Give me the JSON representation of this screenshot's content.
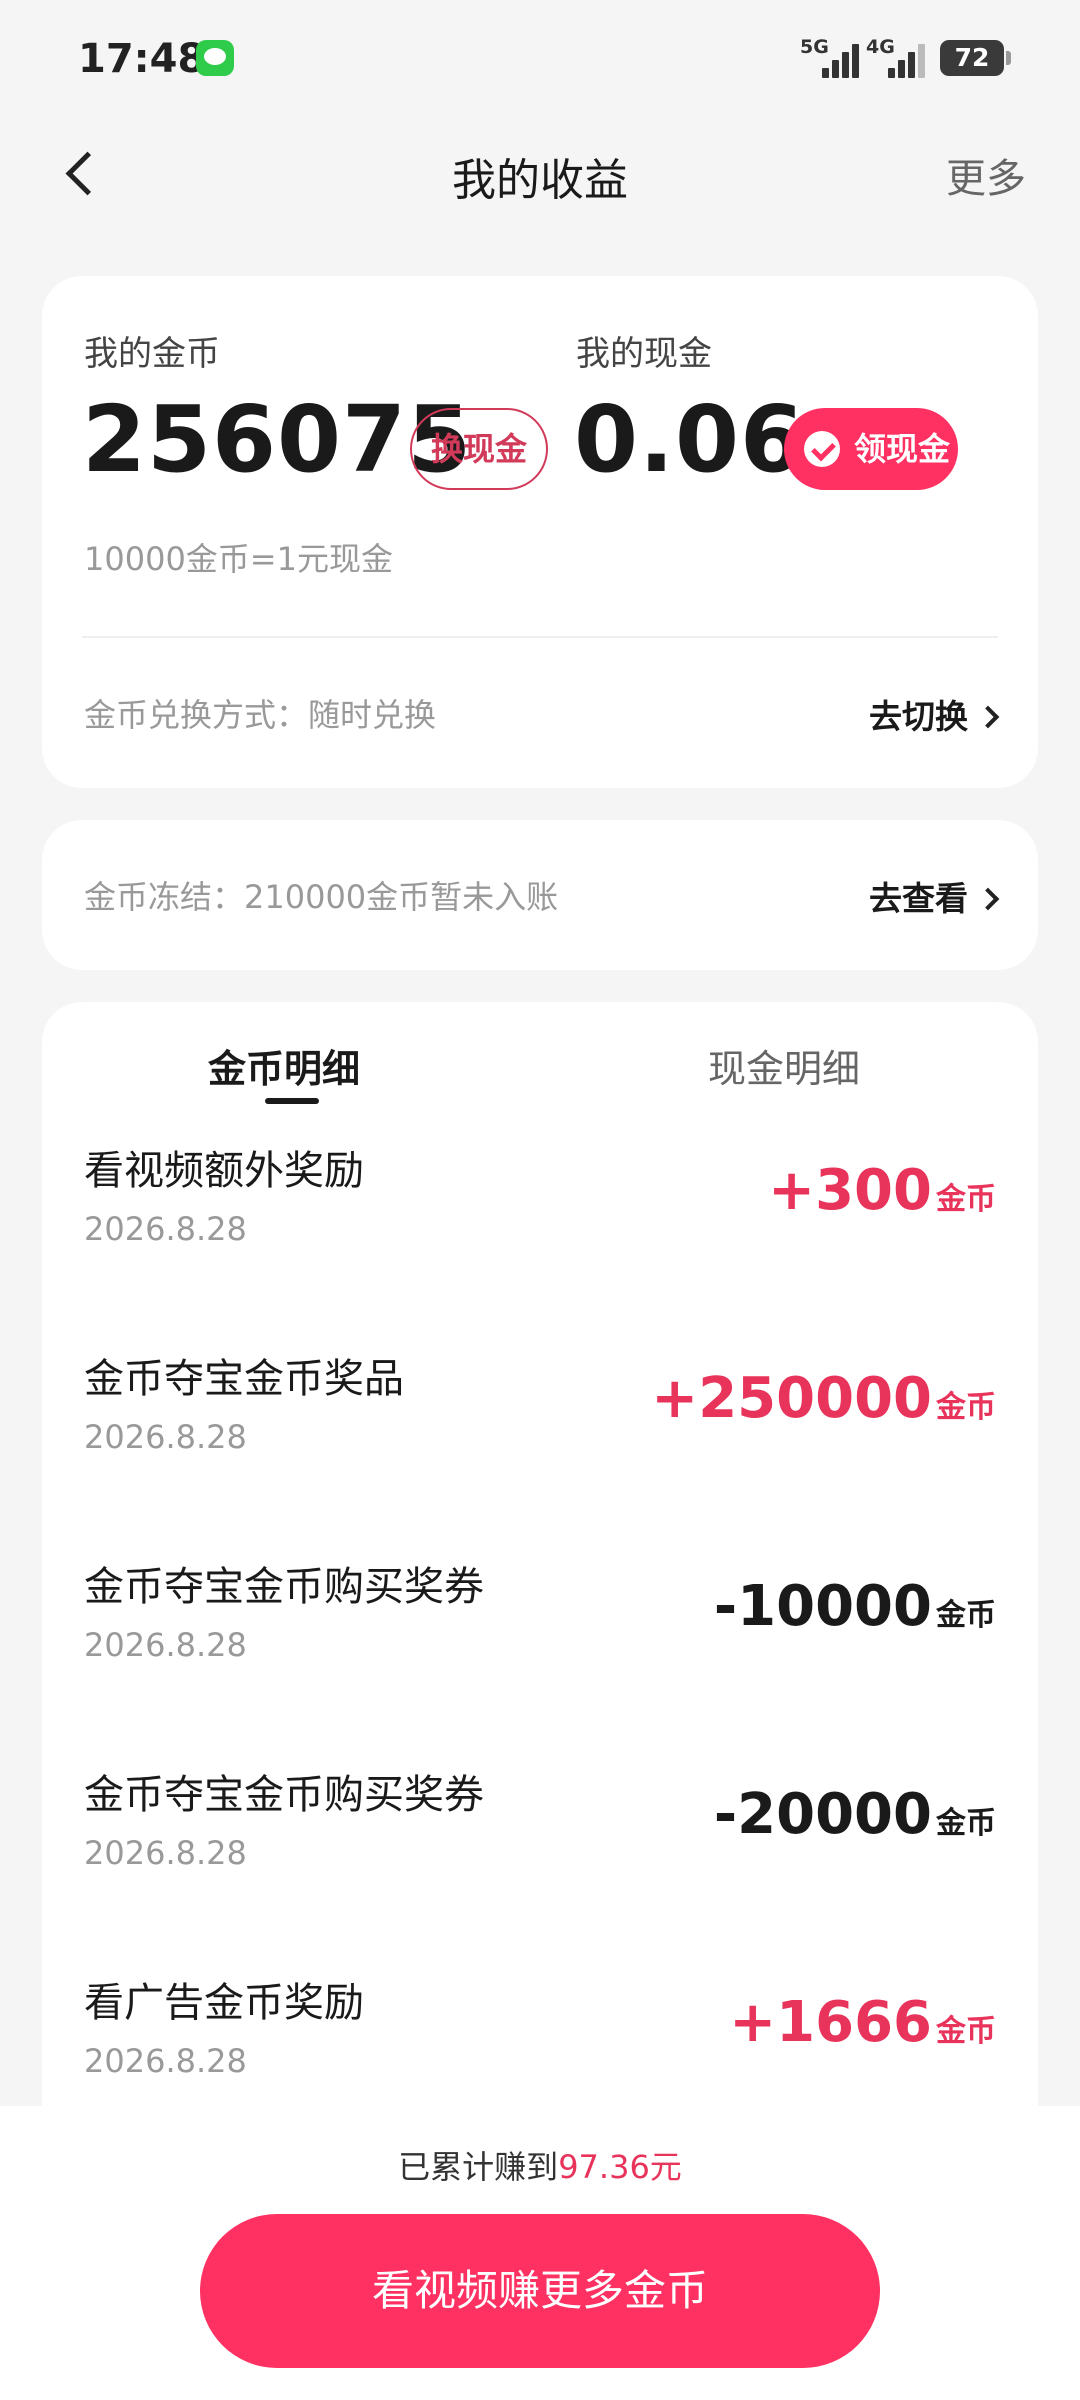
{
  "status_bar": {
    "time": "17:48",
    "net1": "5G",
    "net2": "4G",
    "battery": "72"
  },
  "nav": {
    "title": "我的收益",
    "more": "更多"
  },
  "earnings": {
    "coins_label": "我的金币",
    "coins_value": "256075",
    "exchange_btn": "换现金",
    "cash_label": "我的现金",
    "cash_value": "0.06",
    "withdraw_btn": "领现金",
    "rate": "10000金币=1元现金",
    "mode_text": "金币兑换方式：随时兑换",
    "mode_link": "去切换"
  },
  "frozen": {
    "text": "金币冻结：210000金币暂未入账",
    "link": "去查看"
  },
  "tabs": [
    "金币明细",
    "现金明细"
  ],
  "transactions": [
    {
      "title": "看视频额外奖励",
      "date": "2026.8.28",
      "amount": "+300",
      "unit": "金币"
    },
    {
      "title": "金币夺宝金币奖品",
      "date": "2026.8.28",
      "amount": "+250000",
      "unit": "金币"
    },
    {
      "title": "金币夺宝金币购买奖券",
      "date": "2026.8.28",
      "amount": "-10000",
      "unit": "金币"
    },
    {
      "title": "金币夺宝金币购买奖券",
      "date": "2026.8.28",
      "amount": "-20000",
      "unit": "金币"
    },
    {
      "title": "看广告金币奖励",
      "date": "2026.8.28",
      "amount": "+1666",
      "unit": "金币"
    }
  ],
  "bottom": {
    "total_prefix": "已累计赚到",
    "total_value": "97.36元",
    "cta": "看视频赚更多金币"
  },
  "colors": {
    "accent": "#ff3062",
    "positive": "#e8335b"
  }
}
